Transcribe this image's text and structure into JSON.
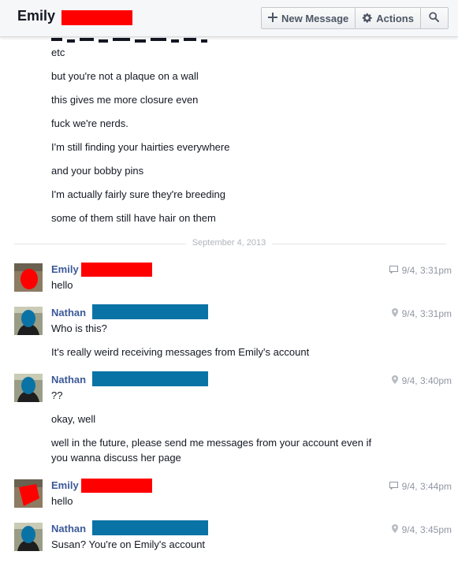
{
  "header": {
    "title": "Emily",
    "new_message_label": "New Message",
    "actions_label": "Actions",
    "new_message_icon": "plus-icon",
    "actions_icon": "gear-icon",
    "search_icon": "search-icon"
  },
  "colors": {
    "redact_red": "#ff0000",
    "redact_blue": "#0a73a6",
    "author_link": "#3b5998"
  },
  "earlier_messages": [
    "etc",
    "but you're not a plaque on a wall",
    "this gives me more closure even",
    "fuck we're nerds.",
    "I'm still finding your hairties everywhere",
    "and your bobby pins",
    "I'm actually fairly sure they're breeding",
    "some of them still have hair on them"
  ],
  "date_divider": "September 4, 2013",
  "groups": [
    {
      "author": "Emily",
      "time": "9/4, 3:31pm",
      "source_icon": "chat-icon",
      "messages": [
        "hello"
      ]
    },
    {
      "author": "Nathan",
      "time": "9/4, 3:31pm",
      "source_icon": "location-pin-icon",
      "messages": [
        "Who is this?",
        "It's really weird receiving messages from Emily's account"
      ]
    },
    {
      "author": "Nathan",
      "time": "9/4, 3:40pm",
      "source_icon": "location-pin-icon",
      "messages": [
        "??",
        "okay, well",
        "well in the future, please send me messages from your account even if",
        "you wanna discuss her page"
      ]
    },
    {
      "author": "Emily",
      "time": "9/4, 3:44pm",
      "source_icon": "chat-icon",
      "messages": [
        "hello"
      ]
    },
    {
      "author": "Nathan",
      "time": "9/4, 3:45pm",
      "source_icon": "location-pin-icon",
      "messages": [
        "Susan? You're on Emily's account"
      ]
    }
  ]
}
